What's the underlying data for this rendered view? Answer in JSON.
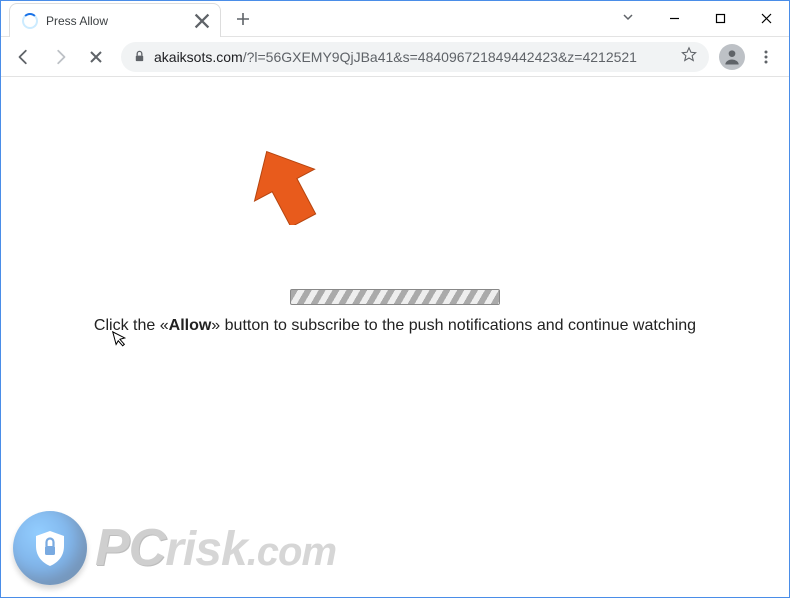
{
  "tab": {
    "title": "Press Allow"
  },
  "url": {
    "domain": "akaiksots.com",
    "path": "/?l=56GXEMY9QjJBa41&s=484096721849442423&z=4212521"
  },
  "page": {
    "instruction_prefix": "Click the «",
    "instruction_bold": "Allow",
    "instruction_suffix": "» button to subscribe to the push notifications and continue watching"
  },
  "watermark": {
    "pc": "PC",
    "risk": "risk",
    "com": ".com"
  }
}
